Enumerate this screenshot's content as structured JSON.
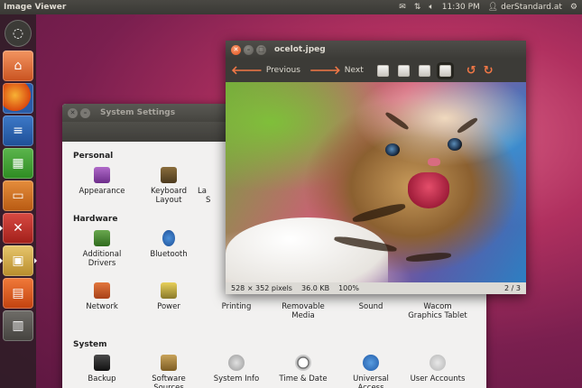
{
  "top_panel": {
    "app_title": "Image Viewer",
    "time": "11:30 PM",
    "user": "derStandard.at",
    "icons": [
      "mail-icon",
      "network-icon",
      "volume-icon",
      "gear-icon"
    ]
  },
  "launcher": {
    "items": [
      "dash-icon",
      "home-folder-icon",
      "firefox-icon",
      "writer-icon",
      "calc-icon",
      "impress-icon",
      "system-settings-icon",
      "image-viewer-icon",
      "software-center-icon",
      "workspace-switcher-icon"
    ]
  },
  "system_settings": {
    "title": "System Settings",
    "sections": {
      "personal": "Personal",
      "hardware": "Hardware",
      "system": "System"
    },
    "items": {
      "appearance": "Appearance",
      "keyboard_layout": "Keyboard Layout",
      "partial_col3": "La",
      "partial_col3b": "S",
      "additional_drivers": "Additional Drivers",
      "bluetooth": "Bluetooth",
      "network": "Network",
      "power": "Power",
      "printing": "Printing",
      "removable_media": "Removable Media",
      "sound": "Sound",
      "wacom": "Wacom Graphics Tablet",
      "backup": "Backup",
      "software_sources": "Software Sources",
      "system_info": "System Info",
      "time_date": "Time & Date",
      "universal_access": "Universal Access",
      "user_accounts": "User Accounts"
    }
  },
  "viewer": {
    "title": "ocelot.jpeg",
    "previous": "Previous",
    "next": "Next",
    "status": {
      "dimensions": "528 × 352 pixels",
      "size": "36.0 KB",
      "zoom": "100%",
      "position": "2 / 3"
    }
  },
  "colors": {
    "accent": "#f07746",
    "panel": "#3c3b37"
  }
}
